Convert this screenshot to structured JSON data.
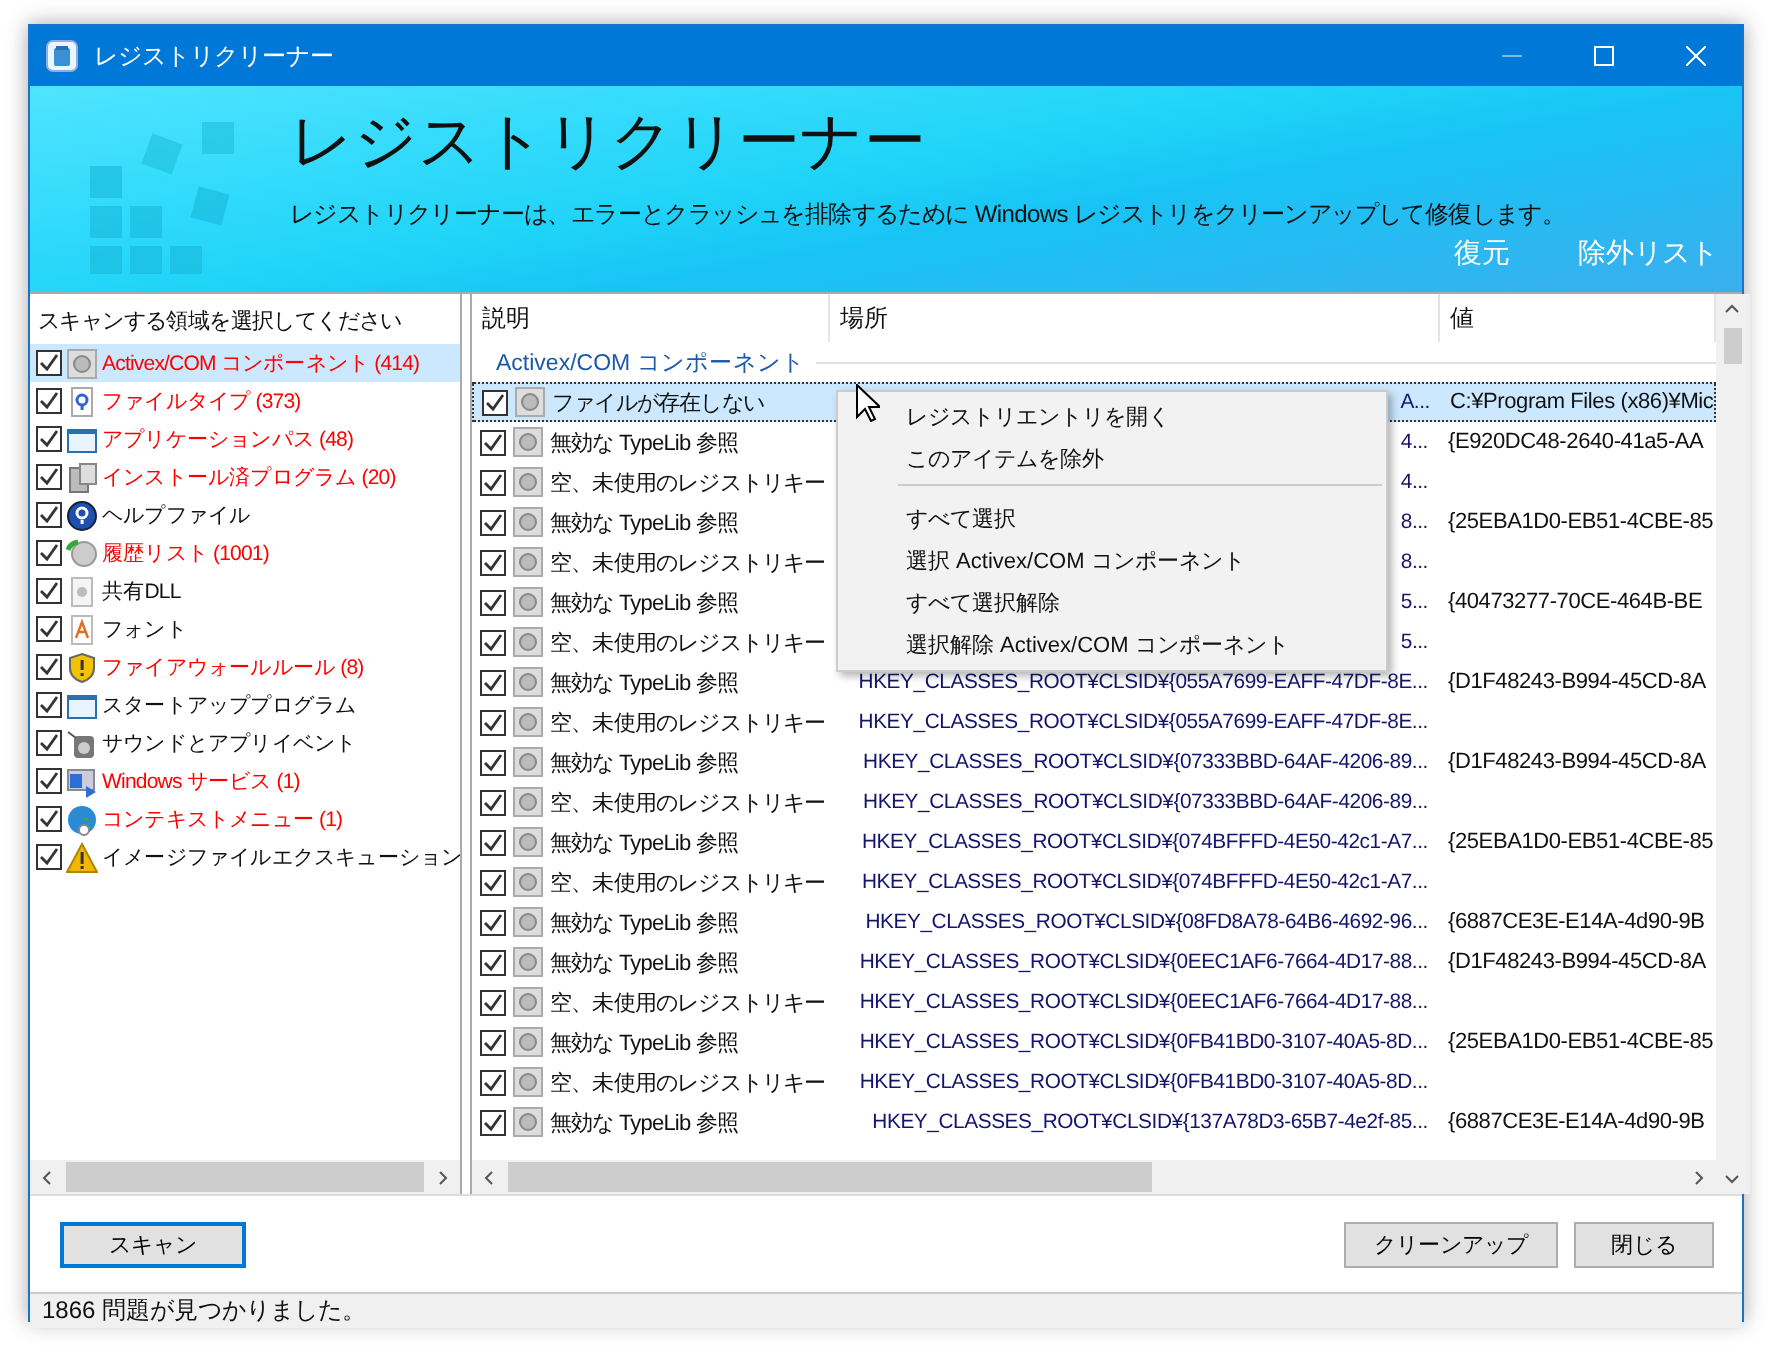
{
  "window": {
    "title": "レジストリクリーナー",
    "controls": [
      {
        "kind": "minimize",
        "disabled": true
      },
      {
        "kind": "maximize",
        "disabled": false
      },
      {
        "kind": "close",
        "disabled": false
      }
    ]
  },
  "header": {
    "title": "レジストリクリーナー",
    "description": "レジストリクリーナーは、エラーとクラッシュを排除するために Windows レジストリをクリーンアップして修復します。",
    "links": [
      "復元",
      "除外リスト"
    ]
  },
  "scan_areas": {
    "heading": "スキャンする領域を選択してください",
    "items": [
      {
        "label": "Activex/COM コンポーネント (414)",
        "checked": true,
        "issues_found": true,
        "selected": true
      },
      {
        "label": "ファイルタイプ (373)",
        "checked": true,
        "issues_found": true,
        "selected": false
      },
      {
        "label": "アプリケーションパス (48)",
        "checked": true,
        "issues_found": true,
        "selected": false
      },
      {
        "label": "インストール済プログラム (20)",
        "checked": true,
        "issues_found": true,
        "selected": false
      },
      {
        "label": "ヘルプファイル",
        "checked": true,
        "issues_found": false,
        "selected": false
      },
      {
        "label": "履歴リスト (1001)",
        "checked": true,
        "issues_found": true,
        "selected": false
      },
      {
        "label": "共有DLL",
        "checked": true,
        "issues_found": false,
        "selected": false
      },
      {
        "label": "フォント",
        "checked": true,
        "issues_found": false,
        "selected": false
      },
      {
        "label": "ファイアウォールルール (8)",
        "checked": true,
        "issues_found": true,
        "selected": false
      },
      {
        "label": "スタートアッププログラム",
        "checked": true,
        "issues_found": false,
        "selected": false
      },
      {
        "label": "サウンドとアプリイベント",
        "checked": true,
        "issues_found": false,
        "selected": false
      },
      {
        "label": "Windows サービス (1)",
        "checked": true,
        "issues_found": true,
        "selected": false
      },
      {
        "label": "コンテキストメニュー (1)",
        "checked": true,
        "issues_found": true,
        "selected": false
      },
      {
        "label": "イメージファイルエクスキューション",
        "checked": true,
        "issues_found": false,
        "selected": false
      }
    ]
  },
  "table": {
    "columns": [
      "説明",
      "場所",
      "値"
    ],
    "group": "Activex/COM コンポーネント",
    "rows": [
      {
        "checked": true,
        "selected": true,
        "description": "ファイルが存在しない",
        "location": "A...",
        "value": "C:¥Program Files (x86)¥Mic"
      },
      {
        "checked": true,
        "selected": false,
        "description": "無効な TypeLib 参照",
        "location": "4...",
        "value": "{E920DC48-2640-41a5-AA"
      },
      {
        "checked": true,
        "selected": false,
        "description": "空、未使用のレジストリキー",
        "location": "4..."
      },
      {
        "checked": true,
        "selected": false,
        "description": "無効な TypeLib 参照",
        "location": "8...",
        "value": "{25EBA1D0-EB51-4CBE-85"
      },
      {
        "checked": true,
        "selected": false,
        "description": "空、未使用のレジストリキー",
        "location": "8..."
      },
      {
        "checked": true,
        "selected": false,
        "description": "無効な TypeLib 参照",
        "location": "5...",
        "value": "{40473277-70CE-464B-BE"
      },
      {
        "checked": true,
        "selected": false,
        "description": "空、未使用のレジストリキー",
        "location": "5..."
      },
      {
        "checked": true,
        "selected": false,
        "description": "無効な TypeLib 参照",
        "location": "HKEY_CLASSES_ROOT¥CLSID¥{055A7699-EAFF-47DF-8E...",
        "value": "{D1F48243-B994-45CD-8A"
      },
      {
        "checked": true,
        "selected": false,
        "description": "空、未使用のレジストリキー",
        "location": "HKEY_CLASSES_ROOT¥CLSID¥{055A7699-EAFF-47DF-8E..."
      },
      {
        "checked": true,
        "selected": false,
        "description": "無効な TypeLib 参照",
        "location": "HKEY_CLASSES_ROOT¥CLSID¥{07333BBD-64AF-4206-89...",
        "value": "{D1F48243-B994-45CD-8A"
      },
      {
        "checked": true,
        "selected": false,
        "description": "空、未使用のレジストリキー",
        "location": "HKEY_CLASSES_ROOT¥CLSID¥{07333BBD-64AF-4206-89..."
      },
      {
        "checked": true,
        "selected": false,
        "description": "無効な TypeLib 参照",
        "location": "HKEY_CLASSES_ROOT¥CLSID¥{074BFFFD-4E50-42c1-A7...",
        "value": "{25EBA1D0-EB51-4CBE-85"
      },
      {
        "checked": true,
        "selected": false,
        "description": "空、未使用のレジストリキー",
        "location": "HKEY_CLASSES_ROOT¥CLSID¥{074BFFFD-4E50-42c1-A7..."
      },
      {
        "checked": true,
        "selected": false,
        "description": "無効な TypeLib 参照",
        "location": "HKEY_CLASSES_ROOT¥CLSID¥{08FD8A78-64B6-4692-96...",
        "value": "{6887CE3E-E14A-4d90-9B"
      },
      {
        "checked": true,
        "selected": false,
        "description": "無効な TypeLib 参照",
        "location": "HKEY_CLASSES_ROOT¥CLSID¥{0EEC1AF6-7664-4D17-88...",
        "value": "{D1F48243-B994-45CD-8A"
      },
      {
        "checked": true,
        "selected": false,
        "description": "空、未使用のレジストリキー",
        "location": "HKEY_CLASSES_ROOT¥CLSID¥{0EEC1AF6-7664-4D17-88..."
      },
      {
        "checked": true,
        "selected": false,
        "description": "無効な TypeLib 参照",
        "location": "HKEY_CLASSES_ROOT¥CLSID¥{0FB41BD0-3107-40A5-8D...",
        "value": "{25EBA1D0-EB51-4CBE-85"
      },
      {
        "checked": true,
        "selected": false,
        "description": "空、未使用のレジストリキー",
        "location": "HKEY_CLASSES_ROOT¥CLSID¥{0FB41BD0-3107-40A5-8D..."
      },
      {
        "checked": true,
        "selected": false,
        "description": "無効な TypeLib 参照",
        "location": "HKEY_CLASSES_ROOT¥CLSID¥{137A78D3-65B7-4e2f-85...",
        "value": "{6887CE3E-E14A-4d90-9B"
      }
    ]
  },
  "context_menu": [
    {
      "kind": "item",
      "label": "レジストリエントリを開く"
    },
    {
      "kind": "item",
      "label": "このアイテムを除外"
    },
    {
      "kind": "separator"
    },
    {
      "kind": "item",
      "label": "すべて選択"
    },
    {
      "kind": "item",
      "label": "選択 Activex/COM コンポーネント"
    },
    {
      "kind": "item",
      "label": "すべて選択解除"
    },
    {
      "kind": "item",
      "label": "選択解除 Activex/COM コンポーネント"
    }
  ],
  "buttons": [
    {
      "label": "スキャン",
      "focused": true
    },
    {
      "label": "クリーンアップ",
      "focused": false
    },
    {
      "label": "閉じる",
      "focused": false
    }
  ],
  "status_bar": "1866 問題が見つかりました。"
}
